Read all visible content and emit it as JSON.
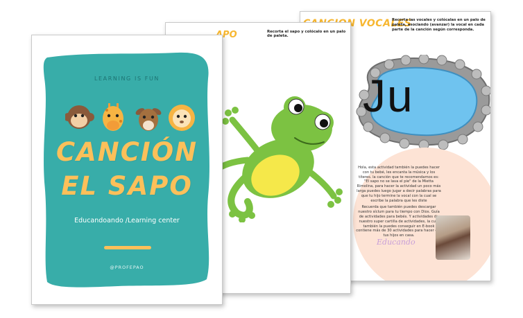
{
  "page3": {
    "title": "CANCION VOCALES",
    "instructions": "Recorta las vocales y colócalas en un palo de paleta, asociando (avanzar) la vocal en cada parte de la canción según corresponda.",
    "letters": "Ju",
    "paragraph": [
      "Hola, esta actividad también la puedes hacer con tu bebé, les encanta la música y los títeres. la canción que te recomendamos es: \"El sapo no se lava el pie\" de la Mietta Rimolina, para hacer la actividad un poco más larga puedes luego jugar a decir palabras para que tu hijo termine la vocal con la cual se escribe la palabra que les diste",
      "Recuerda que también puedes descargar nuestro síclum para tu tiempo con Dios. Guía de actividades para bebés. Y actividades de nuestro super cartilla de actividades, la cual también la puedes conseguir en E-book contiene más de 30 actividades para hacer con tus hijos en casa."
    ],
    "brand": "Educando"
  },
  "page2": {
    "title": "APO",
    "instructions": "Recorta el sapo y colócalo en un palo de paleta."
  },
  "cover": {
    "tagline": "LEARNING IS FUN",
    "title_line1": "CANCIÓN",
    "title_line2": "EL SAPO",
    "subtitle": "Educandoando /Learning center",
    "handle": "@PROFEPAO"
  },
  "colors": {
    "teal": "#38ada9",
    "yellow": "#fcc05a",
    "frog_green": "#7cc242",
    "frog_belly": "#f5e84a",
    "pool_blue": "#6fc3ef",
    "pink": "#fde3d5"
  },
  "icons": [
    "monkey-icon",
    "giraffe-icon",
    "deer-icon",
    "lion-icon",
    "frog-illustration"
  ]
}
